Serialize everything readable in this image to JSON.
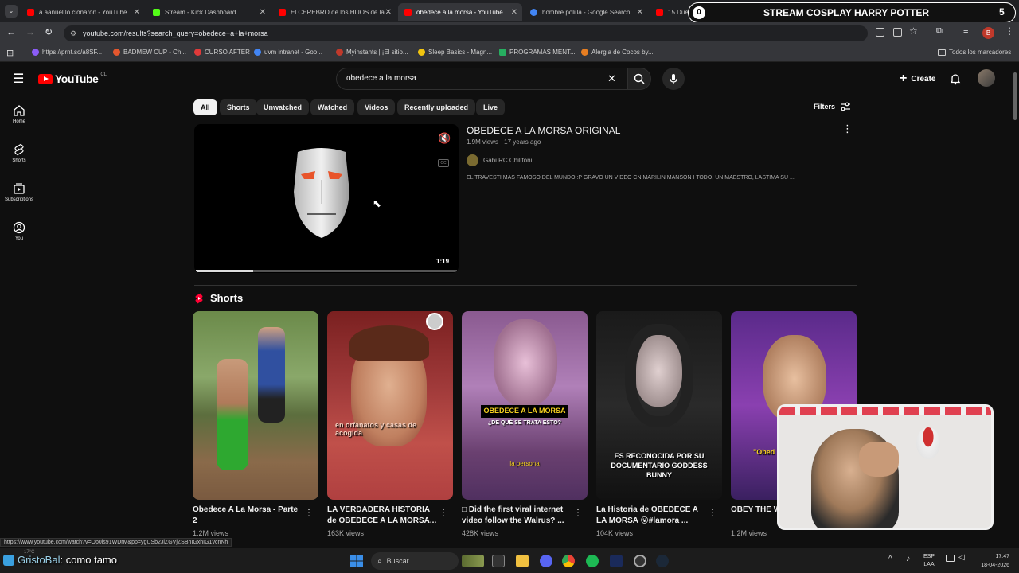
{
  "browser": {
    "tabs": [
      {
        "label": "a aanuel lo clonaron - YouTube",
        "color": "#ff0000"
      },
      {
        "label": "Stream - Kick Dashboard",
        "color": "#53fc18"
      },
      {
        "label": "El CEREBRO de los HIJOS de la",
        "color": "#ff0000"
      },
      {
        "label": "obedece a la morsa - YouTube",
        "color": "#ff0000"
      },
      {
        "label": "hombre polilla - Google Search",
        "color": "#4285f4"
      },
      {
        "label": "15 Due",
        "color": "#ff0000"
      }
    ],
    "url": "youtube.com/results?search_query=obedece+a+la+morsa",
    "bookmarks": [
      {
        "label": "https://prnt.sc/a8SF...",
        "color": "#8b5cf6"
      },
      {
        "label": "BADMEW CUP - Ch...",
        "color": "#e4572e"
      },
      {
        "label": "CURSO AFTER",
        "color": "#e03a3a"
      },
      {
        "label": "uvm intranet - Goo...",
        "color": "#4285f4"
      },
      {
        "label": "Myinstants | ¡El sitio...",
        "color": "#c0392b"
      },
      {
        "label": "Sleep Basics - Magn...",
        "color": "#f1c40f"
      },
      {
        "label": "PROGRAMAS MENT...",
        "color": "#27ae60"
      },
      {
        "label": "Alergia de Cocos by...",
        "color": "#e67e22"
      }
    ],
    "all_bookmarks": "Todos los marcadores",
    "profile_letter": "B"
  },
  "overlay": {
    "stream_title": "STREAM COSPLAY HARRY POTTER",
    "count_left": "0",
    "count_right": "5",
    "chat_user": "GristoBal",
    "chat_message": ": como tamo"
  },
  "youtube": {
    "logo": "YouTube",
    "region": "CL",
    "search_value": "obedece a la morsa",
    "create_label": "Create",
    "sidebar": [
      {
        "label": "Home",
        "icon": "home-icon"
      },
      {
        "label": "Shorts",
        "icon": "shorts-icon"
      },
      {
        "label": "Subscriptions",
        "icon": "subscriptions-icon"
      },
      {
        "label": "You",
        "icon": "you-icon"
      }
    ],
    "chips": [
      "All",
      "Shorts",
      "Unwatched",
      "Watched",
      "Videos",
      "Recently uploaded",
      "Live"
    ],
    "filters_label": "Filters",
    "video": {
      "title": "OBEDECE A LA MORSA ORIGINAL",
      "meta": "1.9M views · 17 years ago",
      "channel": "Gabi RC Chillfoni",
      "description": "EL TRAVESTI MAS FAMOSO DEL MUNDO :P GRAVO UN VIDEO CN MARILIN MANSON I TODO, UN MAESTRO, LASTIMA SU ...",
      "duration": "1:19",
      "progress": 0.22
    },
    "shorts_heading": "Shorts",
    "shorts": [
      {
        "title": "Obedece A La Morsa - Parte 2",
        "views": "1.2M views",
        "overlay": ""
      },
      {
        "title": "LA VERDADERA HISTORIA de OBEDECE A LA MORSA...",
        "views": "163K views",
        "overlay": "en orfanatos y casas de acogida"
      },
      {
        "title": "□ Did the first viral internet video follow the Walrus? ...",
        "views": "428K views",
        "overlay": "OBEDECE A LA MORSA"
      },
      {
        "title": "La Historia de OBEDECE A LA MORSA 😮#lamora ...",
        "views": "104K views",
        "overlay": "ES RECONOCIDA POR SU DOCUMENTARIO GODDESS BUNNY"
      },
      {
        "title": "OBEY THE W #territoriore",
        "views": "1.2M views",
        "overlay": "\"Obed"
      }
    ],
    "short3_sub": "¿DE QUÉ SE TRATA ESTO?",
    "short3_caption": "la persona",
    "status_url": "https://www.youtube.com/watch?v=Op0ls91WDrM&pp=ygUSb2JlZGVjZSBhIGxhIG1vcnNh"
  },
  "taskbar": {
    "search_placeholder": "Buscar",
    "lang": "ESP",
    "lang2": "LAA",
    "time": "17:47",
    "date": "18-04-2026",
    "temp": "17°C"
  }
}
